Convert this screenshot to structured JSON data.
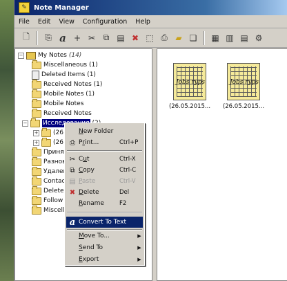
{
  "window": {
    "title": "Note Manager"
  },
  "menubar": [
    "File",
    "Edit",
    "View",
    "Configuration",
    "Help"
  ],
  "toolbar": {
    "icons": [
      "new-note-icon",
      "properties-icon",
      "font-icon",
      "plus-icon",
      "cut-icon",
      "copy-icon",
      "paste-icon",
      "delete-icon",
      "select-icon",
      "print-icon",
      "new-folder-icon",
      "open-icon",
      "large-icons-view-icon",
      "details-view-icon",
      "list-view-icon",
      "more-icon"
    ]
  },
  "tree": {
    "root_label": "My Notes",
    "root_count": "(14)",
    "items": [
      {
        "label": "Miscellaneous (1)",
        "icon": "folder"
      },
      {
        "label": "Deleted Items (1)",
        "icon": "recycle-bin"
      },
      {
        "label": "Received Notes (1)",
        "icon": "folder"
      },
      {
        "label": "Mobile Notes (1)",
        "icon": "folder"
      },
      {
        "label": "Mobile Notes",
        "icon": "folder"
      },
      {
        "label": "Received Notes",
        "icon": "folder"
      }
    ],
    "selected_label": "Исследования",
    "selected_suffix": "(2)",
    "sub_items": [
      "(26",
      "(26"
    ],
    "lower_items": [
      "Принят",
      "Разнов",
      "Удален",
      "Contact",
      "Delete",
      "Follow U",
      "Miscella"
    ]
  },
  "notes": [
    {
      "caption": "(26.05.2015...",
      "scribble": "Jobs ryps"
    },
    {
      "caption": "(26.05.2015...",
      "scribble": "Jobs ryps"
    }
  ],
  "context_menu": {
    "new_folder": {
      "pre": "",
      "u": "N",
      "post": "ew Folder"
    },
    "print": {
      "pre": "P",
      "u": "r",
      "post": "int...",
      "shortcut": "Ctrl+P"
    },
    "cut": {
      "pre": "C",
      "u": "u",
      "post": "t",
      "shortcut": "Ctrl-X"
    },
    "copy": {
      "pre": "",
      "u": "C",
      "post": "opy",
      "shortcut": "Ctrl-C"
    },
    "paste": {
      "pre": "",
      "u": "P",
      "post": "aste",
      "shortcut": "Ctrl-V",
      "disabled": true
    },
    "delete": {
      "pre": "",
      "u": "D",
      "post": "elete",
      "shortcut": "Del"
    },
    "rename": {
      "pre": "",
      "u": "R",
      "post": "ename",
      "shortcut": "F2"
    },
    "convert": {
      "label": "Convert To Text"
    },
    "move_to": {
      "pre": "",
      "u": "M",
      "post": "ove To..."
    },
    "send_to": {
      "pre": "",
      "u": "S",
      "post": "end To"
    },
    "export": {
      "pre": "",
      "u": "E",
      "post": "xport"
    }
  },
  "colors": {
    "selection": "#0a246a",
    "window_bg": "#d4d0c8",
    "note_paper": "#f5ea9a"
  }
}
